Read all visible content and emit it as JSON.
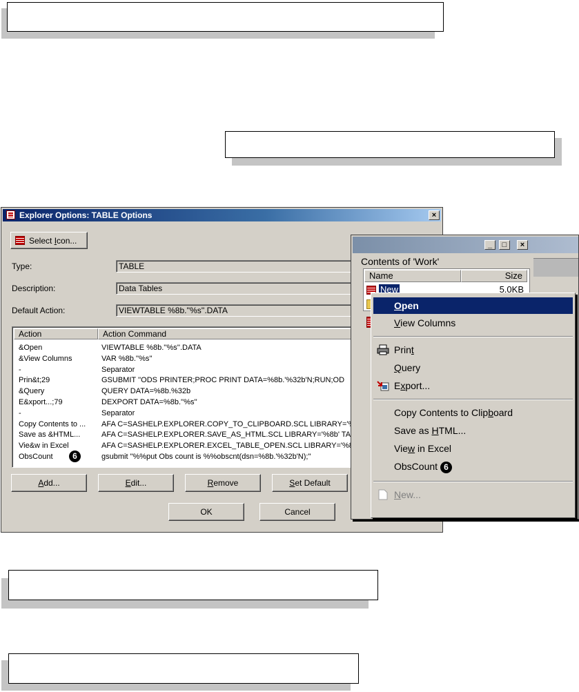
{
  "dialog": {
    "title": "Explorer Options: TABLE Options",
    "close_glyph": "×",
    "select_icon": [
      "Select ",
      "I",
      "con..."
    ],
    "type_label": "Type:",
    "type_value": "TABLE",
    "description_label": "Description:",
    "description_value": "Data Tables",
    "default_action_label": "Default Action:",
    "default_action_value": "VIEWTABLE %8b.''%s''.DATA",
    "columns": [
      "Action",
      "Action Command"
    ],
    "rows": [
      {
        "action": "&Open",
        "command": "VIEWTABLE %8b.''%s''.DATA"
      },
      {
        "action": "&View Columns",
        "command": "VAR %8b.''%s''"
      },
      {
        "action": "-",
        "command": "Separator"
      },
      {
        "action": "Prin&t;29",
        "command": "GSUBMIT ''ODS PRINTER;PROC PRINT DATA=%8b.'%32b'N;RUN;OD"
      },
      {
        "action": "&Query",
        "command": "QUERY DATA=%8b.%32b"
      },
      {
        "action": "E&xport...;79",
        "command": "DEXPORT DATA=%8b.''%s''"
      },
      {
        "action": "-",
        "command": "Separator"
      },
      {
        "action": "Copy Contents to ...",
        "command": "AFA C=SASHELP.EXPLORER.COPY_TO_CLIPBOARD.SCL LIBRARY='%"
      },
      {
        "action": "Save as &HTML...",
        "command": "AFA C=SASHELP.EXPLORER.SAVE_AS_HTML.SCL LIBRARY='%8b' TA"
      },
      {
        "action": "Vie&w in Excel",
        "command": "AFA C=SASHELP.EXPLORER.EXCEL_TABLE_OPEN.SCL LIBRARY='%8"
      },
      {
        "action": "ObsCount",
        "command": "gsubmit \"%%put Obs count is %%obscnt(dsn=%8b.'%32b'N);\"",
        "badge": "6"
      }
    ],
    "buttons": {
      "add": [
        "",
        "A",
        "dd..."
      ],
      "edit": [
        "",
        "E",
        "dit..."
      ],
      "remove": [
        "",
        "R",
        "emove"
      ],
      "set_default": [
        "",
        "S",
        "et Default"
      ],
      "ok": "OK",
      "cancel": "Cancel"
    }
  },
  "work": {
    "title_buttons": [
      "_",
      "□",
      "×"
    ],
    "heading": "Contents of 'Work'",
    "columns": [
      "Name",
      "Size"
    ],
    "first_row": {
      "name": "New",
      "size": "5.0KB"
    }
  },
  "context_menu": {
    "items": [
      {
        "label": [
          "",
          "O",
          "pen"
        ],
        "selected": true,
        "icon": ""
      },
      {
        "label": [
          "",
          "V",
          "iew Columns"
        ],
        "icon": ""
      },
      {
        "label": [
          "Prin",
          "t",
          ""
        ],
        "icon": "printer-icon"
      },
      {
        "label": [
          "",
          "Q",
          "uery"
        ],
        "icon": ""
      },
      {
        "label": [
          "E",
          "x",
          "port..."
        ],
        "icon": "export-icon"
      },
      {
        "label": [
          "Copy Contents to Clip",
          "b",
          "oard"
        ],
        "icon": ""
      },
      {
        "label": [
          "Save as ",
          "H",
          "TML..."
        ],
        "icon": ""
      },
      {
        "label": [
          "Vie",
          "w",
          " in Excel"
        ],
        "icon": ""
      },
      {
        "label": [
          "ObsCount",
          "",
          ""
        ],
        "icon": "",
        "badge": "6"
      },
      {
        "label": [
          "",
          "N",
          "ew..."
        ],
        "icon": "new-icon",
        "disabled": true
      }
    ]
  },
  "colors": {
    "dialog_face": "#d4d0c8",
    "titlebar_active": "#0a246a",
    "menu_highlight": "#0a246a"
  }
}
